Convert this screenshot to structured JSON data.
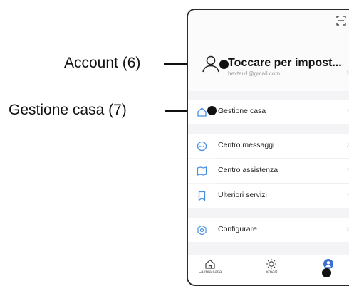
{
  "callouts": {
    "account": "Account (6)",
    "gestione": "Gestione casa (7)"
  },
  "header": {
    "scan_icon": "scan-icon",
    "account_title": "Toccare per impost...",
    "account_email": "hextau1@gmail.com"
  },
  "menu": {
    "gestione_casa": "Gestione casa",
    "centro_messaggi": "Centro messaggi",
    "centro_assistenza": "Centro assistenza",
    "ulteriori_servizi": "Ulteriori servizi",
    "configurare": "Configurare"
  },
  "tabs": {
    "home": "La mia casa",
    "smart": "Smart"
  },
  "colors": {
    "accent": "#4a90e2",
    "active_tab": "#3b6fd6"
  }
}
